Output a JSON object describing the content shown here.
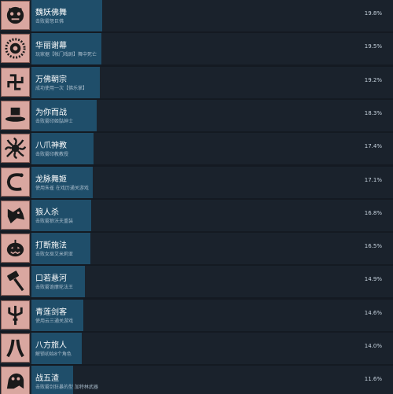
{
  "achievements": [
    {
      "title": "魏妖佛舞",
      "desc": "击败雾怒巨佛",
      "percent": "19.8%",
      "fill": 0.198,
      "icon": "demon-mask-icon"
    },
    {
      "title": "华丽谢幕",
      "desc": "玩家据【帐门戏剧】舞中死亡",
      "percent": "19.5%",
      "fill": 0.195,
      "icon": "rosette-icon"
    },
    {
      "title": "万佛朝宗",
      "desc": "成功使用一次【佛乐掌】",
      "percent": "19.2%",
      "fill": 0.192,
      "icon": "swastika-icon"
    },
    {
      "title": "为你而战",
      "desc": "击败雾印姬骷绅士",
      "percent": "18.3%",
      "fill": 0.183,
      "icon": "top-hat-icon"
    },
    {
      "title": "八爪神教",
      "desc": "击败雾印教教授",
      "percent": "17.4%",
      "fill": 0.174,
      "icon": "octopus-icon"
    },
    {
      "title": "龙脉舞姬",
      "desc": "使用朱雀 在戏历通关游戏",
      "percent": "17.1%",
      "fill": 0.171,
      "icon": "dragon-coil-icon"
    },
    {
      "title": "狼人杀",
      "desc": "击败雾狼沃夫重装",
      "percent": "16.8%",
      "fill": 0.168,
      "icon": "wolf-head-icon"
    },
    {
      "title": "打断施法",
      "desc": "击败女巫艾米莉亚",
      "percent": "16.5%",
      "fill": 0.165,
      "icon": "pumpkin-icon"
    },
    {
      "title": "口若悬河",
      "desc": "击败雾诡摩轮法王",
      "percent": "14.9%",
      "fill": 0.149,
      "icon": "hammer-icon"
    },
    {
      "title": "青莲剑客",
      "desc": "使用云三通关游戏",
      "percent": "14.6%",
      "fill": 0.146,
      "icon": "trident-icon"
    },
    {
      "title": "八方旅人",
      "desc": "解锁初始8个角色",
      "percent": "14.0%",
      "fill": 0.14,
      "icon": "bamboo-icon"
    },
    {
      "title": "战五渣",
      "desc": "击败雾剑狂暴的型 加特林武器",
      "percent": "11.6%",
      "fill": 0.116,
      "icon": "beast-icon"
    }
  ]
}
